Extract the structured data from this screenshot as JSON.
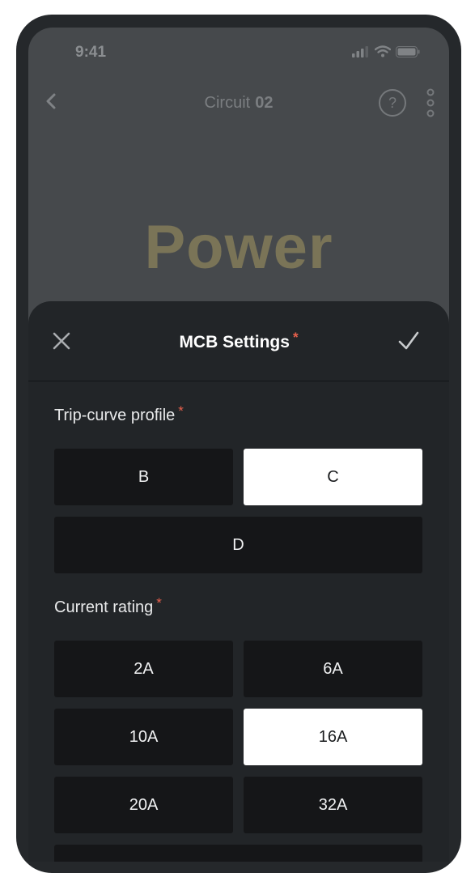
{
  "status_bar": {
    "time": "9:41",
    "icons": [
      "signal-icon",
      "wifi-icon",
      "battery-icon"
    ]
  },
  "nav": {
    "title": "Circuit",
    "number": "02",
    "help_label": "?",
    "icons": [
      "back-chevron-icon",
      "help-icon",
      "more-vertical-icon"
    ]
  },
  "hero": {
    "text": "Power"
  },
  "sheet": {
    "title": "MCB Settings",
    "required_mark": "*",
    "trip_curve": {
      "label": "Trip-curve profile",
      "required_mark": "*",
      "options": [
        "B",
        "C",
        "D"
      ],
      "selected": "C"
    },
    "current_rating": {
      "label": "Current rating",
      "required_mark": "*",
      "options": [
        "2A",
        "6A",
        "10A",
        "16A",
        "20A",
        "32A"
      ],
      "selected": "16A"
    }
  },
  "colors": {
    "accent_required": "#e8604c",
    "hero_text": "#7a7457",
    "sheet_bg": "#222528",
    "option_bg": "#151618",
    "option_selected_bg": "#ffffff"
  }
}
